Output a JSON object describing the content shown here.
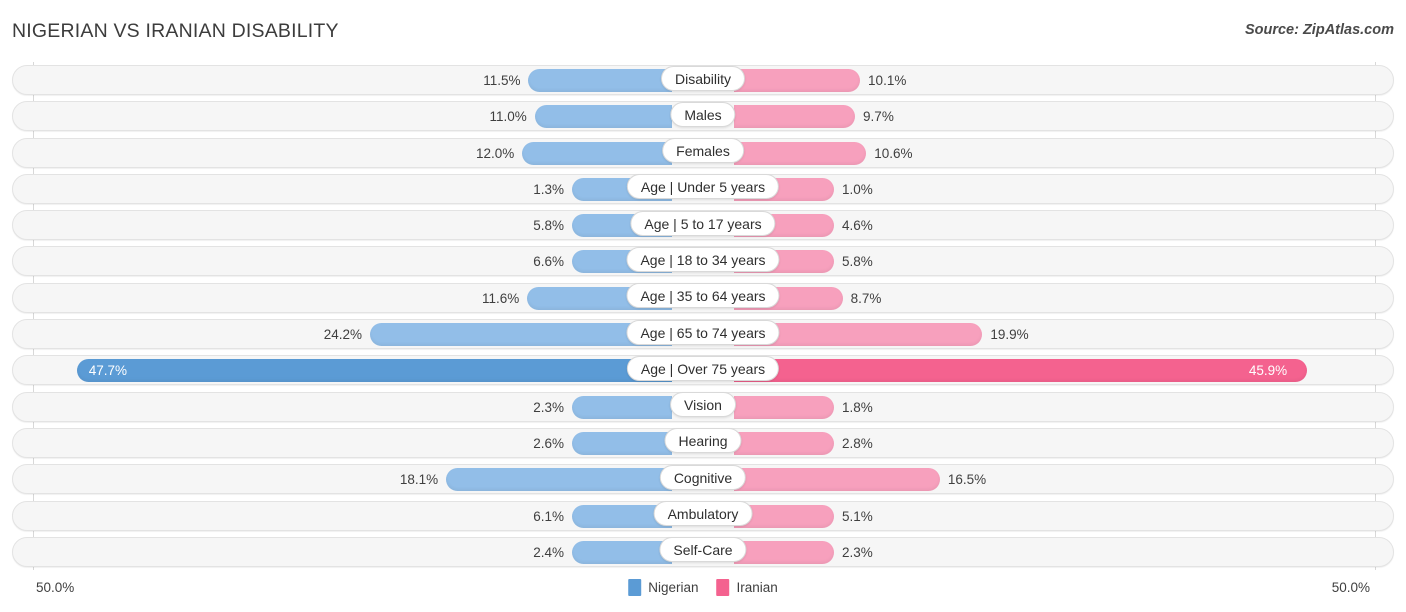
{
  "header": {
    "title": "NIGERIAN VS IRANIAN DISABILITY",
    "source": "Source: ZipAtlas.com"
  },
  "footer": {
    "axis_left": "50.0%",
    "axis_right": "50.0%",
    "legend": [
      {
        "label": "Nigerian",
        "color": "#5b9bd5"
      },
      {
        "label": "Iranian",
        "color": "#f4628f"
      }
    ]
  },
  "colors": {
    "left_pastel": "#92bee8",
    "right_pastel": "#f7a0bd",
    "left_strong": "#5b9bd5",
    "right_strong": "#f4628f",
    "track": "#f6f6f6",
    "gridline": "#d8d8d8"
  },
  "chart_data": {
    "type": "bar",
    "title": "NIGERIAN VS IRANIAN DISABILITY",
    "subtitle": "Source: ZipAtlas.com",
    "orientation": "horizontal-diverging",
    "xlabel": "",
    "ylabel": "",
    "xlim": [
      50.0,
      50.0
    ],
    "axis_left_label": "50.0%",
    "axis_right_label": "50.0%",
    "grid": true,
    "legend_position": "bottom-center",
    "categories": [
      "Disability",
      "Males",
      "Females",
      "Age | Under 5 years",
      "Age | 5 to 17 years",
      "Age | 18 to 34 years",
      "Age | 35 to 64 years",
      "Age | 65 to 74 years",
      "Age | Over 75 years",
      "Vision",
      "Hearing",
      "Cognitive",
      "Ambulatory",
      "Self-Care"
    ],
    "series": [
      {
        "name": "Nigerian",
        "color": "#5b9bd5",
        "values": [
          11.5,
          11.0,
          12.0,
          1.3,
          5.8,
          6.6,
          11.6,
          24.2,
          47.7,
          2.3,
          2.6,
          18.1,
          6.1,
          2.4
        ],
        "labels": [
          "11.5%",
          "11.0%",
          "12.0%",
          "1.3%",
          "5.8%",
          "6.6%",
          "11.6%",
          "24.2%",
          "47.7%",
          "2.3%",
          "2.6%",
          "18.1%",
          "6.1%",
          "2.4%"
        ]
      },
      {
        "name": "Iranian",
        "color": "#f4628f",
        "values": [
          10.1,
          9.7,
          10.6,
          1.0,
          4.6,
          5.8,
          8.7,
          19.9,
          45.9,
          1.8,
          2.8,
          16.5,
          5.1,
          2.3
        ],
        "labels": [
          "10.1%",
          "9.7%",
          "10.6%",
          "1.0%",
          "4.6%",
          "5.8%",
          "8.7%",
          "19.9%",
          "45.9%",
          "1.8%",
          "2.8%",
          "16.5%",
          "5.1%",
          "2.3%"
        ]
      }
    ],
    "highlight_row": "Age | Over 75 years"
  },
  "rows": [
    {
      "label": "Disability",
      "left": "11.5%",
      "right": "10.1%",
      "left_v": 11.5,
      "right_v": 10.1,
      "highlight": false
    },
    {
      "label": "Males",
      "left": "11.0%",
      "right": "9.7%",
      "left_v": 11.0,
      "right_v": 9.7,
      "highlight": false
    },
    {
      "label": "Females",
      "left": "12.0%",
      "right": "10.6%",
      "left_v": 12.0,
      "right_v": 10.6,
      "highlight": false
    },
    {
      "label": "Age | Under 5 years",
      "left": "1.3%",
      "right": "1.0%",
      "left_v": 1.3,
      "right_v": 1.0,
      "highlight": false
    },
    {
      "label": "Age | 5 to 17 years",
      "left": "5.8%",
      "right": "4.6%",
      "left_v": 5.8,
      "right_v": 4.6,
      "highlight": false
    },
    {
      "label": "Age | 18 to 34 years",
      "left": "6.6%",
      "right": "5.8%",
      "left_v": 6.6,
      "right_v": 5.8,
      "highlight": false
    },
    {
      "label": "Age | 35 to 64 years",
      "left": "11.6%",
      "right": "8.7%",
      "left_v": 11.6,
      "right_v": 8.7,
      "highlight": false
    },
    {
      "label": "Age | 65 to 74 years",
      "left": "24.2%",
      "right": "19.9%",
      "left_v": 24.2,
      "right_v": 19.9,
      "highlight": false
    },
    {
      "label": "Age | Over 75 years",
      "left": "47.7%",
      "right": "45.9%",
      "left_v": 47.7,
      "right_v": 45.9,
      "highlight": true
    },
    {
      "label": "Vision",
      "left": "2.3%",
      "right": "1.8%",
      "left_v": 2.3,
      "right_v": 1.8,
      "highlight": false
    },
    {
      "label": "Hearing",
      "left": "2.6%",
      "right": "2.8%",
      "left_v": 2.6,
      "right_v": 2.8,
      "highlight": false
    },
    {
      "label": "Cognitive",
      "left": "18.1%",
      "right": "16.5%",
      "left_v": 18.1,
      "right_v": 16.5,
      "highlight": false
    },
    {
      "label": "Ambulatory",
      "left": "6.1%",
      "right": "5.1%",
      "left_v": 6.1,
      "right_v": 5.1,
      "highlight": false
    },
    {
      "label": "Self-Care",
      "left": "2.4%",
      "right": "2.3%",
      "left_v": 2.4,
      "right_v": 2.3,
      "highlight": false
    }
  ]
}
